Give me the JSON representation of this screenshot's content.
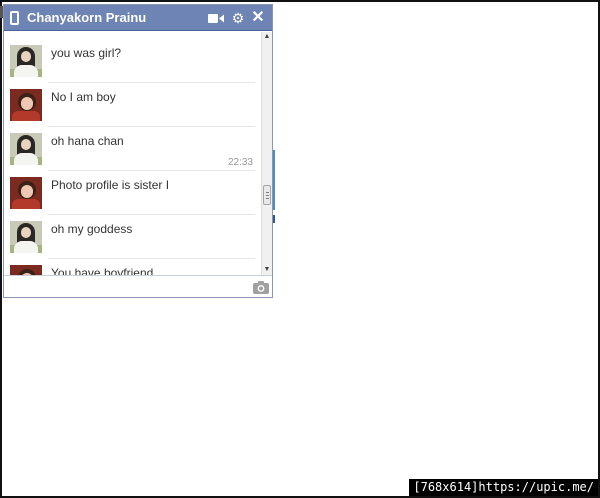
{
  "chat": {
    "title": "Chanyakorn Prainu",
    "input_placeholder": "",
    "messages": [
      {
        "text": "you was girl?",
        "avatar": "girl"
      },
      {
        "text": "No I am boy",
        "avatar": "boy"
      },
      {
        "text": "oh hana chan",
        "avatar": "girl"
      },
      {
        "text": "Photo profile is sister I",
        "avatar": "boy",
        "timestamp": "22:33"
      },
      {
        "text": "oh my goddess",
        "avatar": "girl"
      },
      {
        "text": "You have boyfriend",
        "avatar": "boy"
      }
    ]
  },
  "icons": {
    "header": [
      "phone-icon",
      "video-camera-icon",
      "gear-icon",
      "close-icon"
    ],
    "input": [
      "camera-icon"
    ],
    "scrollbar": [
      "scroll-up-arrow",
      "scroll-down-arrow"
    ]
  },
  "watermark": "[768x614]https://upic.me/",
  "colors": {
    "header": "#6d84b4",
    "header_border": "#4d6199",
    "window_border": "#8d96b1",
    "message_text": "#333333",
    "timestamp": "#999999"
  }
}
